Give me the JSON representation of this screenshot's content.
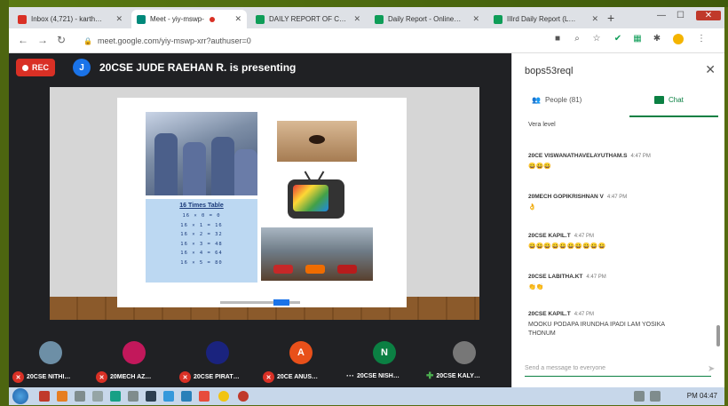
{
  "browser": {
    "tabs": [
      {
        "title": "Inbox (4,721) - karth…",
        "favicon_color": "#d93025",
        "active": false
      },
      {
        "title": "Meet - yiy-mswp-",
        "favicon_color": "#00897b",
        "active": true
      },
      {
        "title": "DAILY REPORT OF C…",
        "favicon_color": "#0f9d58",
        "active": false
      },
      {
        "title": "Daily Report - Online…",
        "favicon_color": "#0f9d58",
        "active": false
      },
      {
        "title": "IIIrd Daily Report (L…",
        "favicon_color": "#0f9d58",
        "active": false
      }
    ],
    "url": "meet.google.com/yiy-mswp-xrr?authuser=0"
  },
  "meet": {
    "rec_label": "REC",
    "presenter_initial": "J",
    "presenting_text": "20CSE JUDE RAEHAN R. is presenting",
    "slide": {
      "table_title": "16 Times Table",
      "table_rows": [
        "16 × 0 = 0",
        "16 × 1 = 16",
        "16 × 2 = 32",
        "16 × 3 = 48",
        "16 × 4 = 64",
        "16 × 5 = 80"
      ]
    },
    "participants": [
      {
        "initial": "",
        "name": "20CSE NITHI…",
        "avatar_color": "#6d8fa6"
      },
      {
        "initial": "",
        "name": "20MECH AZ…",
        "avatar_color": "#c2185b"
      },
      {
        "initial": "",
        "name": "20CSE PIRAT…",
        "avatar_color": "#1a237e"
      },
      {
        "initial": "A",
        "name": "20CE ANUS…",
        "avatar_color": "#e8501a"
      },
      {
        "initial": "N",
        "name": "20CSE NISH…",
        "avatar_color": "#0b8043"
      },
      {
        "initial": "",
        "name": "20CSE KALY…",
        "avatar_color": "#777777"
      }
    ]
  },
  "panel": {
    "title": "bops53reql",
    "people_tab": "People (81)",
    "chat_tab": "Chat",
    "messages": [
      {
        "from": "",
        "time": "",
        "text": "Vera level"
      },
      {
        "from": "20CE VISWANATHAVELAYUTHAM.S",
        "time": "4:47 PM",
        "text": "😀😀😀"
      },
      {
        "from": "20MECH GOPIKRISHNAN V",
        "time": "4:47 PM",
        "text": "👌"
      },
      {
        "from": "20CSE KAPIL.T",
        "time": "4:47 PM",
        "text": "😀😀😀😀😀😀😀😀😀😀"
      },
      {
        "from": "20CSE LABITHA.KT",
        "time": "4:47 PM",
        "text": "👏👏"
      },
      {
        "from": "20CSE KAPIL.T",
        "time": "4:47 PM",
        "text": "MOOKU PODAPA IRUNDHA IPADI LAM YOSIKA THONUM"
      }
    ],
    "compose_placeholder": "Send a message to everyone"
  },
  "taskbar": {
    "clock": "PM 04:47"
  }
}
